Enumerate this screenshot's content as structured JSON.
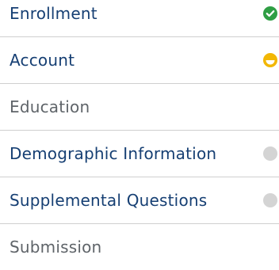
{
  "steps": [
    {
      "label": "Enrollment",
      "status": "complete-icon",
      "state": "active"
    },
    {
      "label": "Account",
      "status": "in-progress-icon",
      "state": "active"
    },
    {
      "label": "Education",
      "status": "",
      "state": "disabled"
    },
    {
      "label": "Demographic Information",
      "status": "not-started-icon",
      "state": "active"
    },
    {
      "label": "Supplemental Questions",
      "status": "not-started-icon",
      "state": "active"
    },
    {
      "label": "Submission",
      "status": "",
      "state": "disabled"
    }
  ],
  "colors": {
    "active_text": "#163f73",
    "inactive_text": "#5f6469",
    "complete": "#2f9e44",
    "in_progress": "#f2b705",
    "not_started": "#d4d4d4",
    "divider": "#cfcfcf"
  }
}
